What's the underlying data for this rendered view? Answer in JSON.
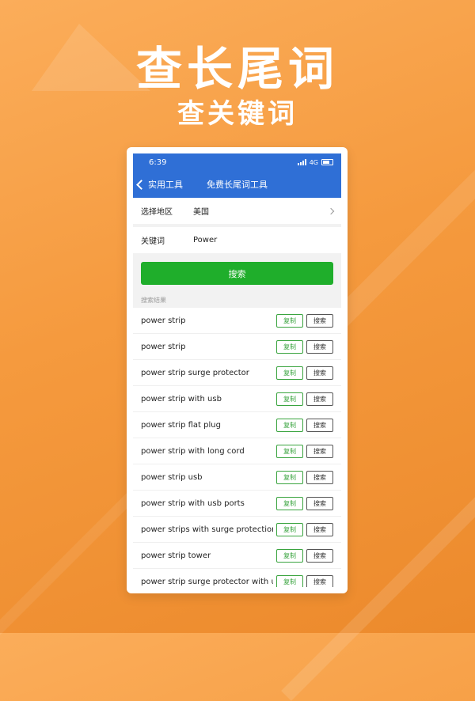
{
  "hero": {
    "title": "查长尾词",
    "subtitle": "查关键词"
  },
  "status": {
    "time": "6:39",
    "network": "4G"
  },
  "nav": {
    "back_label": "实用工具",
    "title": "免费长尾词工具"
  },
  "form": {
    "region_label": "选择地区",
    "region_value": "美国",
    "keyword_label": "关键词",
    "keyword_value": "Power"
  },
  "search_button": "搜索",
  "results_label": "搜索结果",
  "copy_label": "复制",
  "search_label": "搜索",
  "results": [
    "power strip",
    "power strip",
    "power strip surge protector",
    "power strip with usb",
    "power strip flat plug",
    "power strip with long cord",
    "power strip usb",
    "power strip with usb ports",
    "power strips with surge protection",
    "power strip tower",
    "power strip surge protector with u"
  ],
  "colors": {
    "accent_blue": "#2f6fd6",
    "accent_green": "#1fae2b",
    "bg_orange": "#f59a3e"
  }
}
